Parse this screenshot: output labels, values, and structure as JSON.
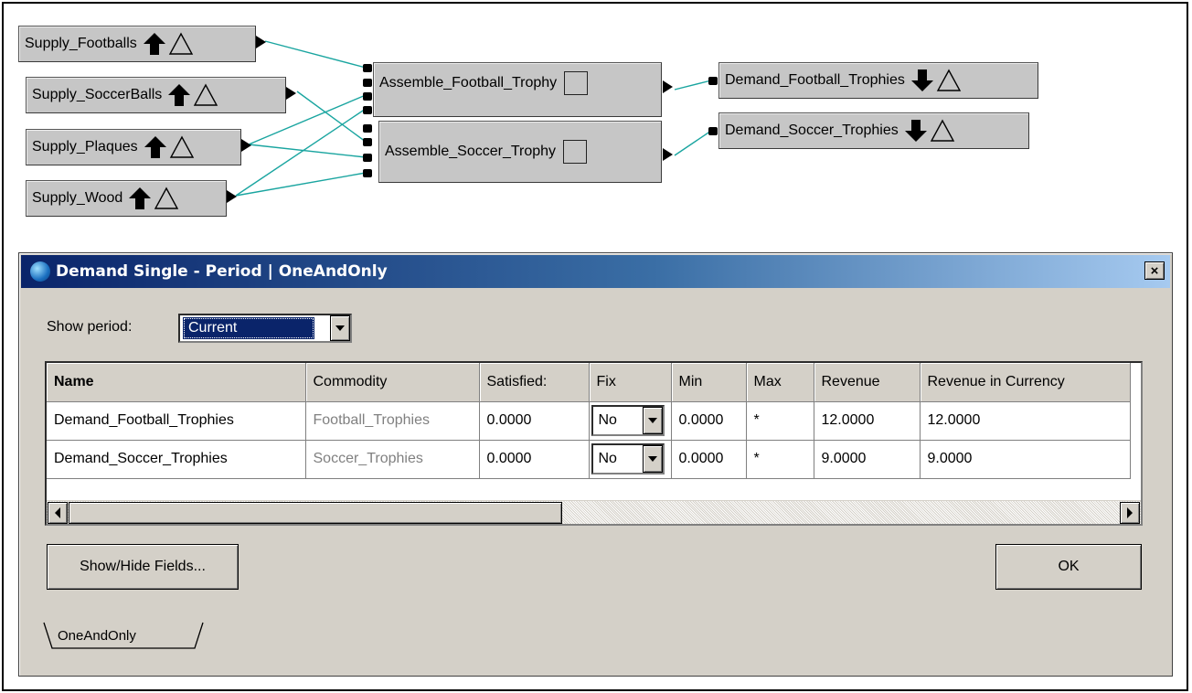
{
  "diagram": {
    "supply_nodes": [
      "Supply_Footballs",
      "Supply_SoccerBalls",
      "Supply_Plaques",
      "Supply_Wood"
    ],
    "assemble_nodes": [
      "Assemble_Football_Trophy",
      "Assemble_Soccer_Trophy"
    ],
    "demand_nodes": [
      "Demand_Football_Trophies",
      "Demand_Soccer_Trophies"
    ],
    "wire_color": "#1aa5a0",
    "icons": {
      "supply": [
        "arrow-up-icon",
        "triangle-icon"
      ],
      "assemble": [
        "square-icon"
      ],
      "demand": [
        "arrow-down-icon",
        "triangle-icon"
      ]
    }
  },
  "dialog": {
    "title": "Demand Single - Period | OneAndOnly",
    "close_label": "×",
    "show_period_label": "Show period:",
    "show_period_value": "Current",
    "columns": [
      "Name",
      "Commodity",
      "Satisfied:",
      "Fix",
      "Min",
      "Max",
      "Revenue",
      "Revenue in Currency"
    ],
    "rows": [
      {
        "name": "Demand_Football_Trophies",
        "commodity": "Football_Trophies",
        "satisfied": "0.0000",
        "fix": "No",
        "min": "0.0000",
        "max": "*",
        "revenue": "12.0000",
        "revenue_currency": "12.0000"
      },
      {
        "name": "Demand_Soccer_Trophies",
        "commodity": "Soccer_Trophies",
        "satisfied": "0.0000",
        "fix": "No",
        "min": "0.0000",
        "max": "*",
        "revenue": "9.0000",
        "revenue_currency": "9.0000"
      }
    ],
    "show_hide_label": "Show/Hide Fields...",
    "ok_label": "OK",
    "tab_label": "OneAndOnly",
    "titlebar_colors": [
      "#0a246a",
      "#a6caf0"
    ]
  }
}
